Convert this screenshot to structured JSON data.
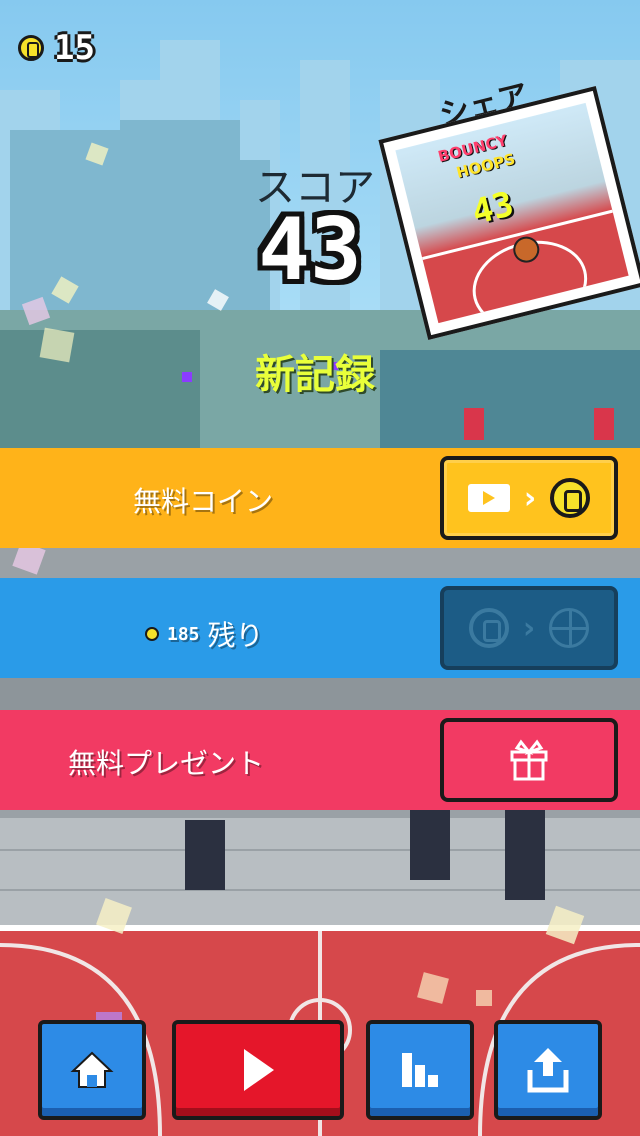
{
  "hud": {
    "coin_count": "15",
    "coin_icon": "coin-icon"
  },
  "result": {
    "score_label": "スコア",
    "score_value": "43",
    "new_record": "新記録"
  },
  "share": {
    "label": "シェア",
    "card_logo_line1": "BOUNCY",
    "card_logo_line2": "HOOPS",
    "card_score": "43"
  },
  "bars": {
    "free_coins": {
      "label": "無料コイン",
      "button_icons": [
        "video-icon",
        "chevron-right-icon",
        "coin-icon"
      ],
      "color": "#ffb319"
    },
    "remaining": {
      "coin_value": "185",
      "label": "残り",
      "button_icons": [
        "coin-icon",
        "chevron-right-icon",
        "basketball-icon"
      ],
      "color": "#2a9be8"
    },
    "free_gift": {
      "label": "無料プレゼント",
      "button_icons": [
        "gift-icon"
      ],
      "color": "#f23a63"
    }
  },
  "bottom_nav": [
    {
      "name": "home-icon"
    },
    {
      "name": "play-icon"
    },
    {
      "name": "leaderboard-icon"
    },
    {
      "name": "share-icon"
    }
  ],
  "colors": {
    "sky": "#a5dbf6",
    "court": "#d6484b",
    "record_text": "#e9ff3a"
  }
}
